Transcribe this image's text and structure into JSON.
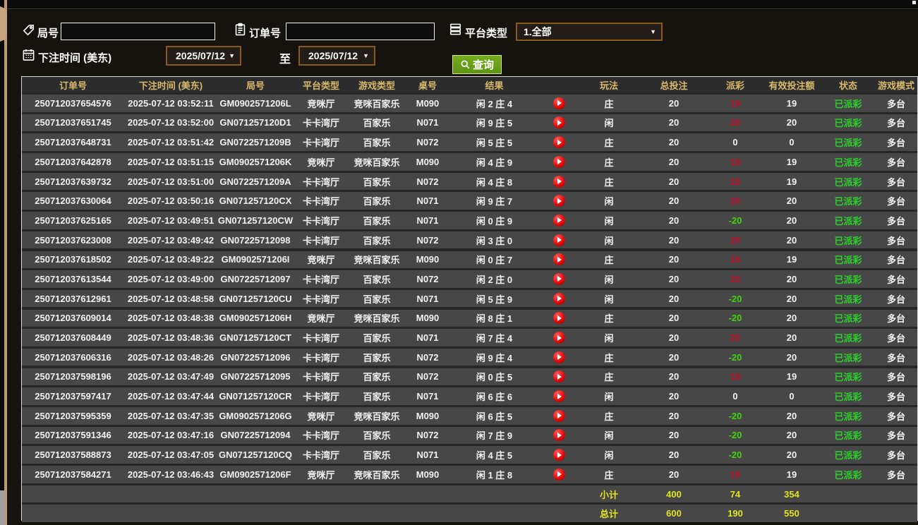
{
  "filters": {
    "round_label": "局号",
    "round_value": "",
    "order_label": "订单号",
    "order_value": "",
    "platform_label": "平台类型",
    "platform_selected": "1.全部",
    "bet_time_label": "下注时间 (美东)",
    "date_from": "2025/07/12",
    "to_label": "至",
    "date_to": "2025/07/12",
    "search_label": "查询"
  },
  "colors": {
    "accent_gold": "#d8b96b",
    "payout_positive": "#c00d27",
    "payout_negative": "#41d40e",
    "status_green": "#2bd12b",
    "summary_yellow": "#e2e41f",
    "button_green": "#6da41e",
    "picker_border": "#8a5a1d",
    "edge_tan": "#c7a480"
  },
  "table": {
    "columns": [
      "订单号",
      "下注时间 (美东)",
      "局号",
      "平台类型",
      "游戏类型",
      "桌号",
      "结果",
      "",
      "玩法",
      "总投注",
      "派彩",
      "有效投注额",
      "状态",
      "游戏模式"
    ],
    "rows": [
      {
        "order": "250712037654576",
        "time": "2025-07-12 03:52:11",
        "round": "GM0902571206L",
        "platform": "竞咪厅",
        "game": "竞咪百家乐",
        "table_no": "M090",
        "result": "闲 2 庄 4",
        "bet_type": "庄",
        "total_bet": "20",
        "payout": "19",
        "valid_bet": "19",
        "status": "已派彩",
        "mode": "多台"
      },
      {
        "order": "250712037651745",
        "time": "2025-07-12 03:52:00",
        "round": "GN071257120D1",
        "platform": "卡卡湾厅",
        "game": "百家乐",
        "table_no": "N071",
        "result": "闲 9 庄 5",
        "bet_type": "闲",
        "total_bet": "20",
        "payout": "20",
        "valid_bet": "20",
        "status": "已派彩",
        "mode": "多台"
      },
      {
        "order": "250712037648731",
        "time": "2025-07-12 03:51:42",
        "round": "GN0722571209B",
        "platform": "卡卡湾厅",
        "game": "百家乐",
        "table_no": "N072",
        "result": "闲 5 庄 5",
        "bet_type": "庄",
        "total_bet": "20",
        "payout": "0",
        "valid_bet": "0",
        "status": "已派彩",
        "mode": "多台"
      },
      {
        "order": "250712037642878",
        "time": "2025-07-12 03:51:15",
        "round": "GM0902571206K",
        "platform": "竞咪厅",
        "game": "竞咪百家乐",
        "table_no": "M090",
        "result": "闲 4 庄 9",
        "bet_type": "庄",
        "total_bet": "20",
        "payout": "19",
        "valid_bet": "19",
        "status": "已派彩",
        "mode": "多台"
      },
      {
        "order": "250712037639732",
        "time": "2025-07-12 03:51:00",
        "round": "GN0722571209A",
        "platform": "卡卡湾厅",
        "game": "百家乐",
        "table_no": "N072",
        "result": "闲 4 庄 8",
        "bet_type": "庄",
        "total_bet": "20",
        "payout": "19",
        "valid_bet": "19",
        "status": "已派彩",
        "mode": "多台"
      },
      {
        "order": "250712037630064",
        "time": "2025-07-12 03:50:16",
        "round": "GN071257120CX",
        "platform": "卡卡湾厅",
        "game": "百家乐",
        "table_no": "N071",
        "result": "闲 9 庄 7",
        "bet_type": "闲",
        "total_bet": "20",
        "payout": "20",
        "valid_bet": "20",
        "status": "已派彩",
        "mode": "多台"
      },
      {
        "order": "250712037625165",
        "time": "2025-07-12 03:49:51",
        "round": "GN071257120CW",
        "platform": "卡卡湾厅",
        "game": "百家乐",
        "table_no": "N071",
        "result": "闲 0 庄 9",
        "bet_type": "闲",
        "total_bet": "20",
        "payout": "-20",
        "valid_bet": "20",
        "status": "已派彩",
        "mode": "多台"
      },
      {
        "order": "250712037623008",
        "time": "2025-07-12 03:49:42",
        "round": "GN07225712098",
        "platform": "卡卡湾厅",
        "game": "百家乐",
        "table_no": "N072",
        "result": "闲 3 庄 0",
        "bet_type": "闲",
        "total_bet": "20",
        "payout": "20",
        "valid_bet": "20",
        "status": "已派彩",
        "mode": "多台"
      },
      {
        "order": "250712037618502",
        "time": "2025-07-12 03:49:22",
        "round": "GM0902571206I",
        "platform": "竞咪厅",
        "game": "竞咪百家乐",
        "table_no": "M090",
        "result": "闲 0 庄 7",
        "bet_type": "庄",
        "total_bet": "20",
        "payout": "19",
        "valid_bet": "19",
        "status": "已派彩",
        "mode": "多台"
      },
      {
        "order": "250712037613544",
        "time": "2025-07-12 03:49:00",
        "round": "GN07225712097",
        "platform": "卡卡湾厅",
        "game": "百家乐",
        "table_no": "N072",
        "result": "闲 2 庄 0",
        "bet_type": "闲",
        "total_bet": "20",
        "payout": "20",
        "valid_bet": "20",
        "status": "已派彩",
        "mode": "多台"
      },
      {
        "order": "250712037612961",
        "time": "2025-07-12 03:48:58",
        "round": "GN071257120CU",
        "platform": "卡卡湾厅",
        "game": "百家乐",
        "table_no": "N071",
        "result": "闲 5 庄 9",
        "bet_type": "闲",
        "total_bet": "20",
        "payout": "-20",
        "valid_bet": "20",
        "status": "已派彩",
        "mode": "多台"
      },
      {
        "order": "250712037609014",
        "time": "2025-07-12 03:48:38",
        "round": "GM0902571206H",
        "platform": "竞咪厅",
        "game": "竞咪百家乐",
        "table_no": "M090",
        "result": "闲 8 庄 1",
        "bet_type": "庄",
        "total_bet": "20",
        "payout": "-20",
        "valid_bet": "20",
        "status": "已派彩",
        "mode": "多台"
      },
      {
        "order": "250712037608449",
        "time": "2025-07-12 03:48:36",
        "round": "GN071257120CT",
        "platform": "卡卡湾厅",
        "game": "百家乐",
        "table_no": "N071",
        "result": "闲 7 庄 4",
        "bet_type": "闲",
        "total_bet": "20",
        "payout": "20",
        "valid_bet": "20",
        "status": "已派彩",
        "mode": "多台"
      },
      {
        "order": "250712037606316",
        "time": "2025-07-12 03:48:26",
        "round": "GN07225712096",
        "platform": "卡卡湾厅",
        "game": "百家乐",
        "table_no": "N072",
        "result": "闲 9 庄 4",
        "bet_type": "庄",
        "total_bet": "20",
        "payout": "-20",
        "valid_bet": "20",
        "status": "已派彩",
        "mode": "多台"
      },
      {
        "order": "250712037598196",
        "time": "2025-07-12 03:47:49",
        "round": "GN07225712095",
        "platform": "卡卡湾厅",
        "game": "百家乐",
        "table_no": "N072",
        "result": "闲 0 庄 5",
        "bet_type": "庄",
        "total_bet": "20",
        "payout": "19",
        "valid_bet": "19",
        "status": "已派彩",
        "mode": "多台"
      },
      {
        "order": "250712037597417",
        "time": "2025-07-12 03:47:44",
        "round": "GN071257120CR",
        "platform": "卡卡湾厅",
        "game": "百家乐",
        "table_no": "N071",
        "result": "闲 6 庄 6",
        "bet_type": "闲",
        "total_bet": "20",
        "payout": "0",
        "valid_bet": "0",
        "status": "已派彩",
        "mode": "多台"
      },
      {
        "order": "250712037595359",
        "time": "2025-07-12 03:47:35",
        "round": "GM0902571206G",
        "platform": "竞咪厅",
        "game": "竞咪百家乐",
        "table_no": "M090",
        "result": "闲 6 庄 5",
        "bet_type": "庄",
        "total_bet": "20",
        "payout": "-20",
        "valid_bet": "20",
        "status": "已派彩",
        "mode": "多台"
      },
      {
        "order": "250712037591346",
        "time": "2025-07-12 03:47:16",
        "round": "GN07225712094",
        "platform": "卡卡湾厅",
        "game": "百家乐",
        "table_no": "N072",
        "result": "闲 7 庄 9",
        "bet_type": "闲",
        "total_bet": "20",
        "payout": "-20",
        "valid_bet": "20",
        "status": "已派彩",
        "mode": "多台"
      },
      {
        "order": "250712037588873",
        "time": "2025-07-12 03:47:05",
        "round": "GN071257120CQ",
        "platform": "卡卡湾厅",
        "game": "百家乐",
        "table_no": "N071",
        "result": "闲 4 庄 5",
        "bet_type": "闲",
        "total_bet": "20",
        "payout": "-20",
        "valid_bet": "20",
        "status": "已派彩",
        "mode": "多台"
      },
      {
        "order": "250712037584271",
        "time": "2025-07-12 03:46:43",
        "round": "GM0902571206F",
        "platform": "竞咪厅",
        "game": "竞咪百家乐",
        "table_no": "M090",
        "result": "闲 1 庄 8",
        "bet_type": "庄",
        "total_bet": "20",
        "payout": "19",
        "valid_bet": "19",
        "status": "已派彩",
        "mode": "多台"
      }
    ],
    "subtotal": {
      "label": "小计",
      "total_bet": "400",
      "payout": "74",
      "valid_bet": "354"
    },
    "total": {
      "label": "总计",
      "total_bet": "600",
      "payout": "190",
      "valid_bet": "550"
    }
  }
}
